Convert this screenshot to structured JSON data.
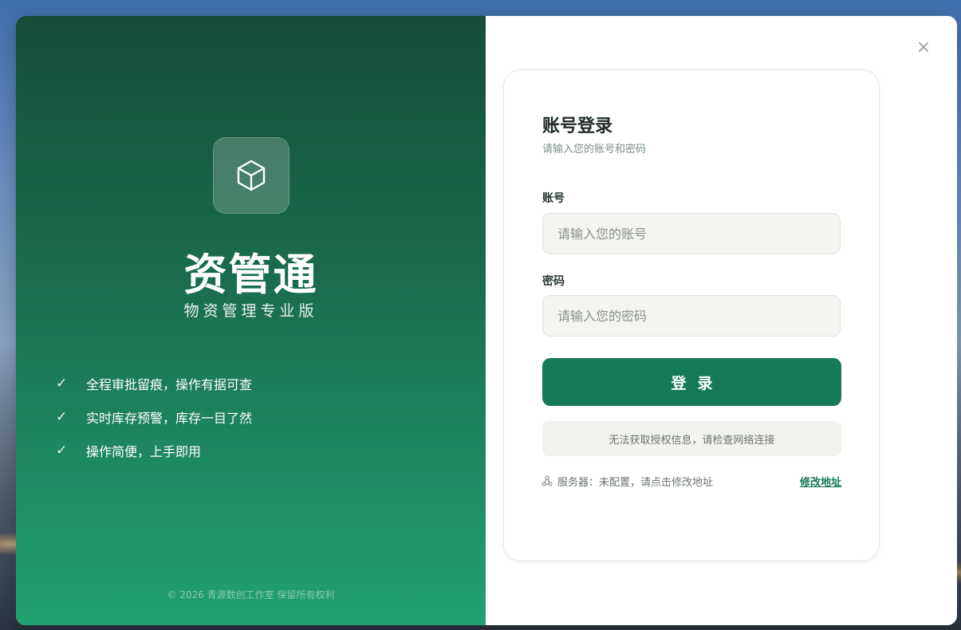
{
  "brand": {
    "name": "资管通",
    "edition": "物资管理专业版",
    "logo_icon": "cube-icon"
  },
  "features": [
    {
      "check": "✓",
      "text": "全程审批留痕，操作有据可查"
    },
    {
      "check": "✓",
      "text": "实时库存预警，库存一目了然"
    },
    {
      "check": "✓",
      "text": "操作简便，上手即用"
    }
  ],
  "copyright": "© 2026 青源数创工作室  保留所有权利",
  "window": {
    "close_symbol": "×"
  },
  "login": {
    "title": "账号登录",
    "subtitle": "请输入您的账号和密码",
    "account_label": "账号",
    "account_placeholder": "请输入您的账号",
    "account_value": "",
    "password_label": "密码",
    "password_placeholder": "请输入您的密码",
    "password_value": "",
    "submit_label": "登录",
    "notice": "无法获取授权信息，请检查网络连接",
    "server_text": "服务器：未配置，请点击修改地址",
    "server_icon": "network-icon",
    "modify_link": "修改地址"
  },
  "colors": {
    "accent": "#167a57",
    "left_panel_top": "#164d39",
    "left_panel_bottom": "#21a171"
  }
}
